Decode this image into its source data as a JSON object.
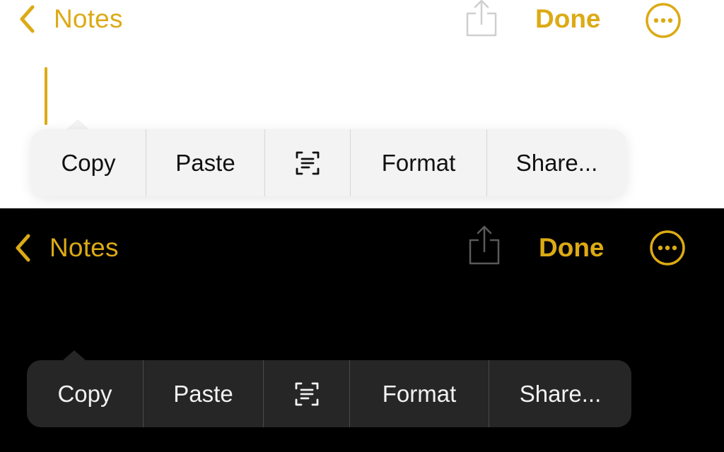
{
  "accent_color": "#dcaa15",
  "light_mode": {
    "nav": {
      "back_label": "Notes",
      "done_label": "Done"
    },
    "menu": {
      "copy": "Copy",
      "paste": "Paste",
      "scan_text_icon": "scan-text-icon",
      "format": "Format",
      "share": "Share..."
    }
  },
  "dark_mode": {
    "nav": {
      "back_label": "Notes",
      "done_label": "Done"
    },
    "menu": {
      "copy": "Copy",
      "paste": "Paste",
      "scan_text_icon": "scan-text-icon",
      "format": "Format",
      "share": "Share..."
    }
  }
}
